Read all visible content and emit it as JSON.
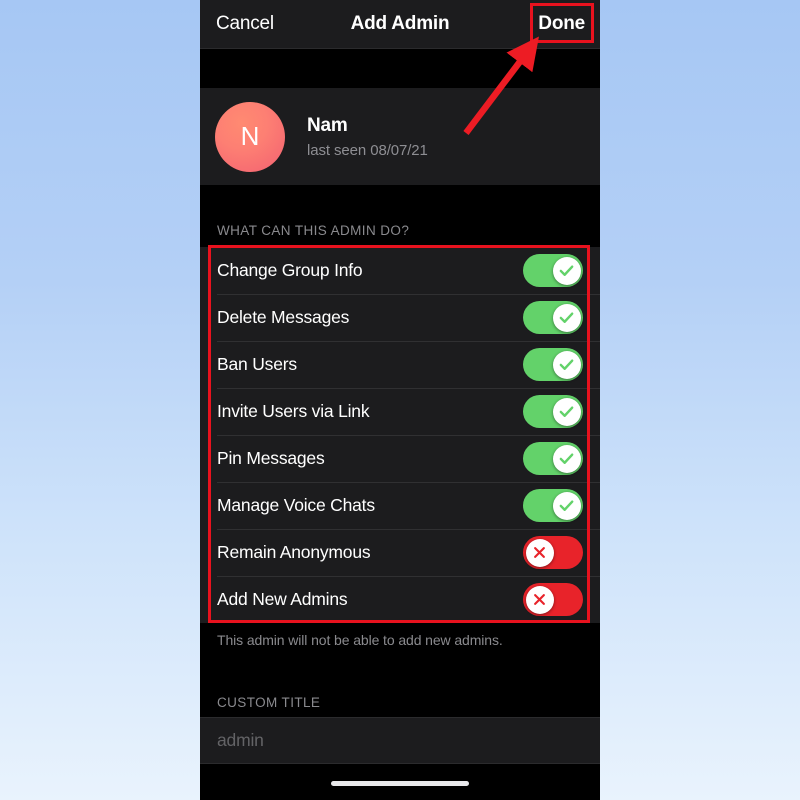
{
  "navbar": {
    "cancel_label": "Cancel",
    "title": "Add Admin",
    "done_label": "Done"
  },
  "profile": {
    "avatar_letter": "N",
    "avatar_color": "#fa7a72",
    "name": "Nam",
    "status": "last seen 08/07/21"
  },
  "permissions_section": {
    "header": "WHAT CAN THIS ADMIN DO?",
    "rows": [
      {
        "label": "Change Group Info",
        "enabled": true
      },
      {
        "label": "Delete Messages",
        "enabled": true
      },
      {
        "label": "Ban Users",
        "enabled": true
      },
      {
        "label": "Invite Users via Link",
        "enabled": true
      },
      {
        "label": "Pin Messages",
        "enabled": true
      },
      {
        "label": "Manage Voice Chats",
        "enabled": true
      },
      {
        "label": "Remain Anonymous",
        "enabled": false
      },
      {
        "label": "Add New Admins",
        "enabled": false
      }
    ],
    "footer_note": "This admin will not be able to add new admins.",
    "on_color": "#63d26a",
    "off_color": "#e8232a"
  },
  "custom_title_section": {
    "header": "CUSTOM TITLE",
    "input_value": "",
    "input_placeholder": "admin"
  },
  "annotations": {
    "highlight_color": "#e8121e",
    "done_box_target": "Done",
    "list_box_target": "WHAT CAN THIS ADMIN DO?",
    "arrow_points_to": "Done"
  }
}
